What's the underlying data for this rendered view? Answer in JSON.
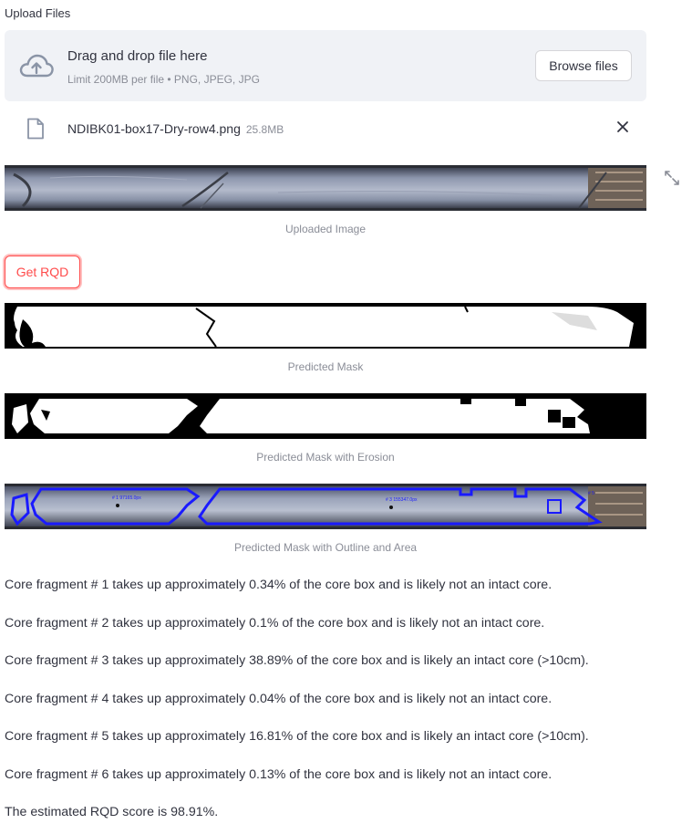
{
  "uploader": {
    "label": "Upload Files",
    "drop_title": "Drag and drop file here",
    "drop_subtitle": "Limit 200MB per file • PNG, JPEG, JPG",
    "browse_label": "Browse files",
    "icon": "cloud-upload-icon"
  },
  "file": {
    "name": "NDIBK01-box17-Dry-row4.png",
    "size": "25.8MB",
    "icon": "file-icon",
    "remove_icon": "close-icon"
  },
  "images": {
    "uploaded_caption": "Uploaded Image",
    "mask_caption": "Predicted Mask",
    "erosion_caption": "Predicted Mask with Erosion",
    "outline_caption": "Predicted Mask with Outline and Area",
    "outline_labels": [
      "# 1 97165.0px",
      "# 3 155347.0px",
      "# 5"
    ]
  },
  "actions": {
    "get_rqd_label": "Get RQD"
  },
  "results": [
    "Core fragment # 1 takes up approximately 0.34% of the core box and is likely not an intact core.",
    "Core fragment # 2 takes up approximately 0.1% of the core box and is likely not an intact core.",
    "Core fragment # 3 takes up approximately 38.89% of the core box and is likely an intact core (>10cm).",
    "Core fragment # 4 takes up approximately 0.04% of the core box and is likely not an intact core.",
    "Core fragment # 5 takes up approximately 16.81% of the core box and is likely an intact core (>10cm).",
    "Core fragment # 6 takes up approximately 0.13% of the core box and is likely not an intact core."
  ],
  "summary": "The estimated RQD score is 98.91%.",
  "colors": {
    "primary": "#ff4b4b",
    "text": "#31333f",
    "muted": "#8a8d97",
    "dropzone_bg": "#f0f2f6",
    "outline_blue": "#1a1aff"
  }
}
